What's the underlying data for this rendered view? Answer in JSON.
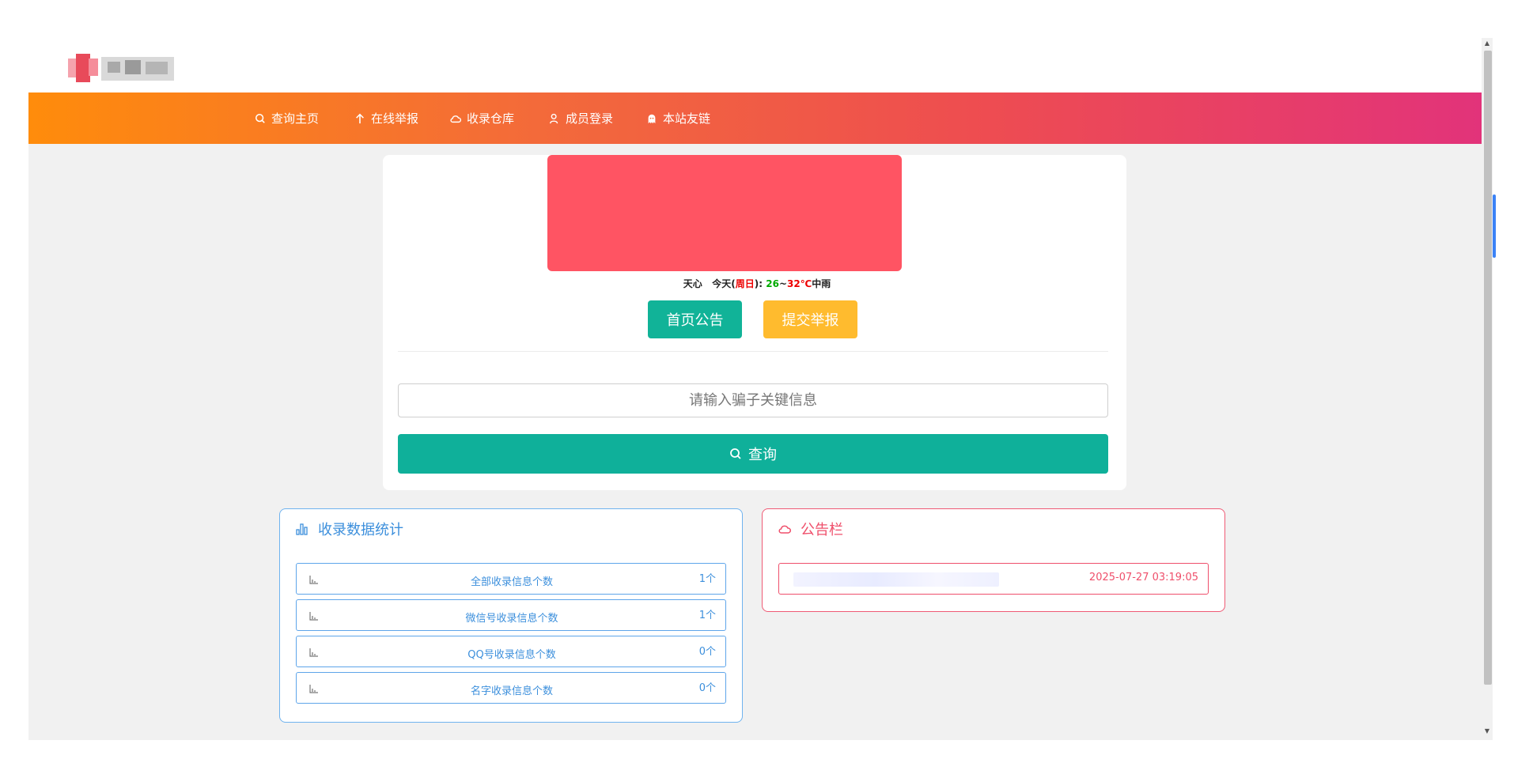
{
  "nav": {
    "items": [
      {
        "label": "查询主页",
        "icon": "search-icon"
      },
      {
        "label": "在线举报",
        "icon": "arrow-up-icon"
      },
      {
        "label": "收录仓库",
        "icon": "cloud-icon"
      },
      {
        "label": "成员登录",
        "icon": "user-icon"
      },
      {
        "label": "本站友链",
        "icon": "ghost-icon"
      }
    ]
  },
  "weather": {
    "city": "天心",
    "today": "今天(",
    "weekday": "周日",
    "sep": "):",
    "low": "26",
    "tilde": "~",
    "high": "32℃",
    "condition": "中雨"
  },
  "actions": {
    "announcement": "首页公告",
    "report": "提交举报"
  },
  "search": {
    "placeholder": "请输入骗子关键信息",
    "button": "查询"
  },
  "stats": {
    "title": "收录数据统计",
    "rows": [
      {
        "label": "全部收录信息个数",
        "count": "1个"
      },
      {
        "label": "微信号收录信息个数",
        "count": "1个"
      },
      {
        "label": "QQ号收录信息个数",
        "count": "0个"
      },
      {
        "label": "名字收录信息个数",
        "count": "0个"
      }
    ]
  },
  "notice": {
    "title": "公告栏",
    "items": [
      {
        "time": "2025-07-27 03:19:05"
      }
    ]
  },
  "colors": {
    "accent_green": "#11b398",
    "accent_yellow": "#ffbb2e",
    "stats_blue": "#3c8fdc",
    "notice_red": "#ef4f6b",
    "banner": "#ff5463"
  }
}
